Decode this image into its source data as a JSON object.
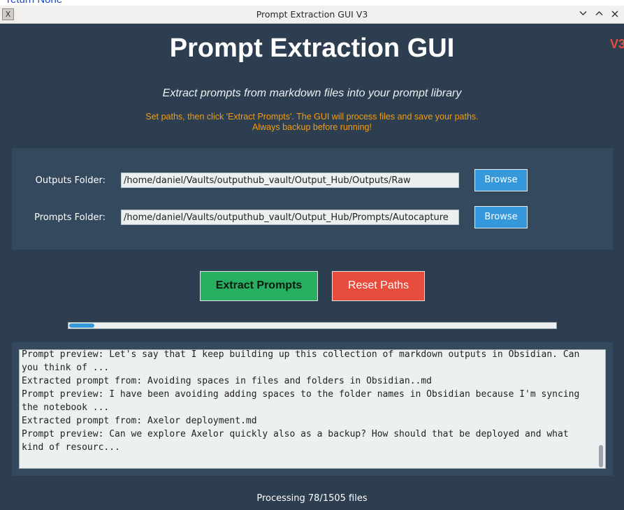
{
  "background_window": {
    "text": "return None"
  },
  "window": {
    "title": "Prompt Extraction GUI V3"
  },
  "header": {
    "title": "Prompt Extraction GUI",
    "version_badge": "V3",
    "subtitle": "Extract prompts from markdown files into your prompt library",
    "instructions_line1": "Set paths, then click 'Extract Prompts'. The GUI will process files and save your paths.",
    "instructions_line2": "Always backup before running!"
  },
  "paths": {
    "outputs_label": "Outputs Folder:",
    "outputs_value": "/home/daniel/Vaults/outputhub_vault/Output_Hub/Outputs/Raw",
    "prompts_label": "Prompts Folder:",
    "prompts_value": "/home/daniel/Vaults/outputhub_vault/Output_Hub/Prompts/Autocapture",
    "browse_label": "Browse"
  },
  "actions": {
    "extract_label": "Extract Prompts",
    "reset_label": "Reset Paths"
  },
  "progress": {
    "processed": 78,
    "total": 1505
  },
  "log": {
    "lines": [
      "Prompt preview: Let's say that I keep building up this collection of markdown outputs in Obsidian. Can you think of ...",
      "Extracted prompt from: Avoiding spaces in files and folders in Obsidian..md",
      "Prompt preview: I have been avoiding adding spaces to the folder names in Obsidian because I'm syncing the notebook ...",
      "Extracted prompt from: Axelor deployment.md",
      "Prompt preview: Can we explore Axelor quickly also as a backup? How should that be deployed and what kind of resourc..."
    ]
  },
  "status": {
    "text": "Processing 78/1505 files"
  },
  "colors": {
    "background": "#2c3e50",
    "panel": "#34495e",
    "accent_blue": "#3498db",
    "green": "#27ae60",
    "red": "#e74c3c",
    "orange": "#f39c12"
  },
  "icons": {
    "app": "x-app-icon",
    "minimize": "chevron-down-icon",
    "maximize": "chevron-up-icon",
    "close": "close-icon"
  }
}
